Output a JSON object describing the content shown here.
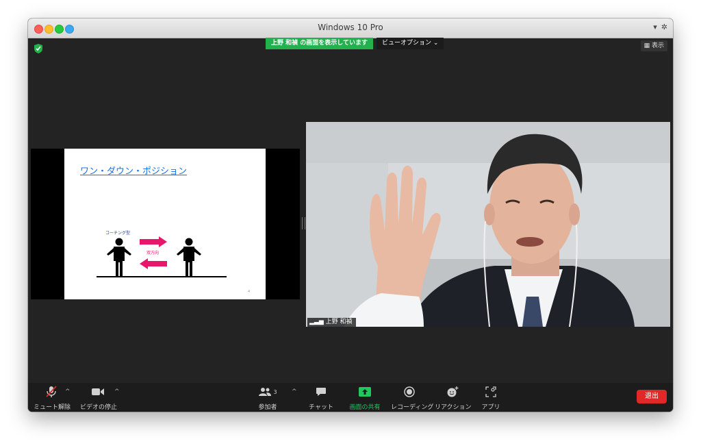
{
  "window": {
    "title": "Windows 10 Pro"
  },
  "banner": {
    "sharing_text": "上野 和禎 の画面を表示しています",
    "view_options": "ビューオプション ⌄"
  },
  "top_right": {
    "display_label": "表示"
  },
  "slide": {
    "title": "ワン・ダウン・ポジション",
    "coaching_label": "コーチング型",
    "bidirectional_label": "双方向",
    "page_number": "4"
  },
  "video": {
    "participant_name": "上野 和禎"
  },
  "toolbar": {
    "mute_label": "ミュート解除",
    "video_label": "ビデオの停止",
    "participants_label": "参加者",
    "participants_count": "3",
    "chat_label": "チャット",
    "share_label": "画面の共有",
    "record_label": "レコーディング",
    "reactions_label": "リアクション",
    "apps_label": "アプリ",
    "leave_label": "退出"
  },
  "colors": {
    "share_green": "#22b14c",
    "leave_red": "#e02828",
    "slide_arrow": "#e8176b",
    "title_blue": "#1a73e8"
  }
}
